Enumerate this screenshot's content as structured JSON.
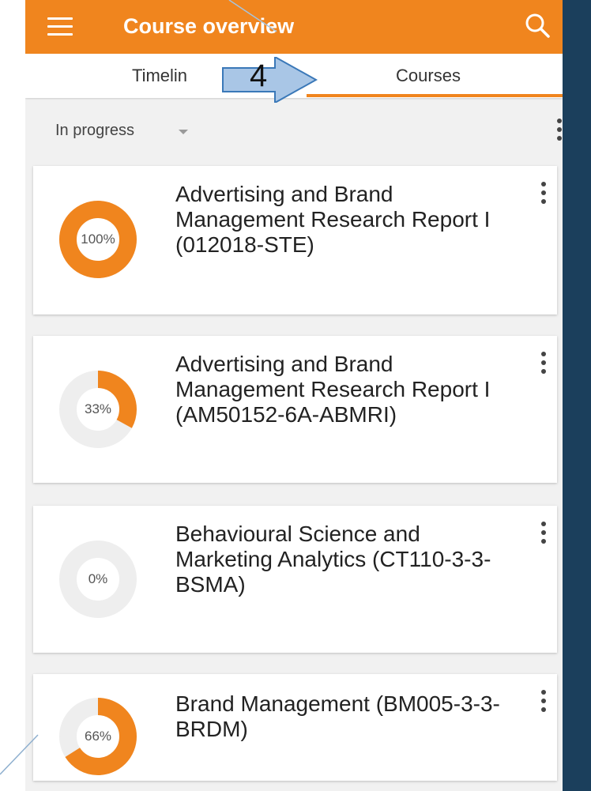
{
  "header": {
    "title": "Course overview",
    "menu_icon": "hamburger-menu-icon",
    "search_icon": "search-icon",
    "accent_color": "#f0851e"
  },
  "tabs": [
    {
      "label": "Timelin",
      "active": false
    },
    {
      "label": "Courses",
      "active": true
    }
  ],
  "annotation": {
    "number": "4"
  },
  "filter": {
    "selected": "In progress"
  },
  "courses": [
    {
      "progress": 100,
      "progress_label": "100%",
      "name": "Advertising and Brand Management Research Report I (012018-STE)"
    },
    {
      "progress": 33,
      "progress_label": "33%",
      "name": "Advertising and Brand Management Research Report I (AM50152-6A-ABMRI)"
    },
    {
      "progress": 0,
      "progress_label": "0%",
      "name": "Behavioural Science and Marketing Analytics (CT110-3-3-BSMA)"
    },
    {
      "progress": 66,
      "progress_label": "66%",
      "name": "Brand Management (BM005-3-3-BRDM)"
    }
  ]
}
